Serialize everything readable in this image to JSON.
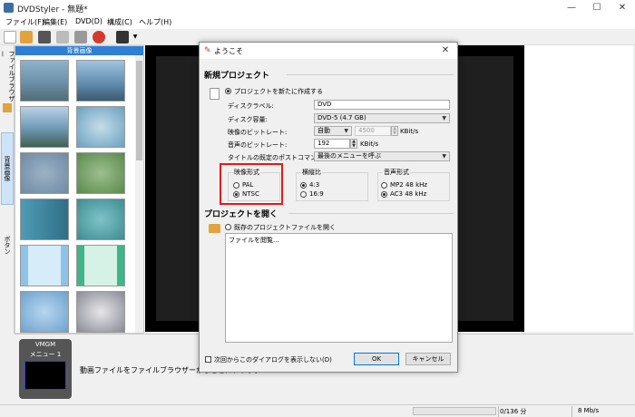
{
  "window": {
    "title": "DVDStyler - 無題*",
    "minimize": "—",
    "maximize": "☐",
    "close": "✕"
  },
  "menu": [
    "ファイル(F)",
    "編集(E)",
    "DVD(D)",
    "構成(C)",
    "ヘルプ(H)"
  ],
  "toolbar": {
    "buttons": [
      "new-file-icon",
      "open-folder-icon",
      "save-icon",
      "wand-icon",
      "tools-icon",
      "burn-icon",
      "film-icon",
      "dropdown-arrow-icon"
    ]
  },
  "left_tabs": [
    "ファイルブラウザー",
    "背景画像",
    "ボタン"
  ],
  "thumbs": {
    "header": "背景画像"
  },
  "titleset": {
    "vmgm_label": "VMGM",
    "menu_label": "メニュー 1",
    "drop_hint": "動画ファイルをファイルブラウザーからここにドラッグ"
  },
  "statusbar": {
    "size": "0/136 分",
    "rate": "8 Mb/s"
  },
  "dialog": {
    "title": "ようこそ",
    "close": "✕",
    "new_project": {
      "section": "新規プロジェクト",
      "create_option": "プロジェクトを新たに作成する",
      "disc_label": {
        "label": "ディスクラベル:",
        "value": "DVD"
      },
      "disc_capacity": {
        "label": "ディスク容量:",
        "value": "DVD-5 (4.7 GB)"
      },
      "video_bitrate": {
        "label": "映像のビットレート:",
        "mode": "自動",
        "value": "4500",
        "unit": "KBit/s"
      },
      "audio_bitrate": {
        "label": "音声のビットレート:",
        "value": "192",
        "unit": "KBit/s"
      },
      "post_command": {
        "label": "タイトルの既定のポストコマンド:",
        "value": "最後のメニューを呼ぶ"
      },
      "video_format": {
        "title": "映像形式",
        "options": [
          "PAL",
          "NTSC"
        ],
        "selected": "NTSC"
      },
      "aspect_ratio": {
        "title": "横縦比",
        "options": [
          "4:3",
          "16:9"
        ],
        "selected": "4:3"
      },
      "audio_format": {
        "title": "音声形式",
        "options": [
          "MP2 48 kHz",
          "AC3 48 kHz"
        ],
        "selected": "AC3 48 kHz"
      }
    },
    "open_project": {
      "section": "プロジェクトを開く",
      "open_option": "既存のプロジェクトファイルを開く",
      "list_items": [
        "ファイルを閲覧..."
      ]
    },
    "dont_show": "次回からこのダイアログを表示しない(D)",
    "ok": "OK",
    "cancel": "キャンセル"
  },
  "colors": {
    "highlight": "#e11a1a",
    "accent": "#2f7fd6",
    "default_button_border": "#0078d7"
  }
}
